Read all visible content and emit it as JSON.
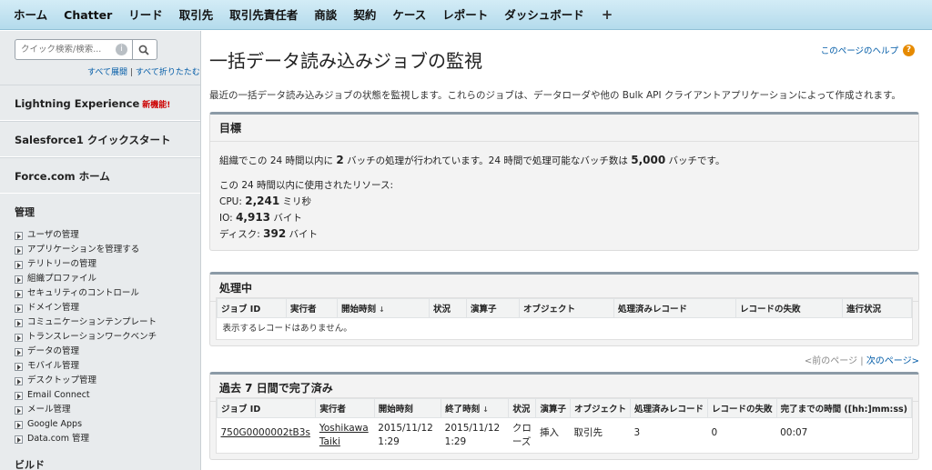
{
  "nav": {
    "tabs": [
      "ホーム",
      "Chatter",
      "リード",
      "取引先",
      "取引先責任者",
      "商談",
      "契約",
      "ケース",
      "レポート",
      "ダッシュボード"
    ],
    "plus": "+"
  },
  "sidebar": {
    "search_placeholder": "クイック検索/検索...",
    "expand_all": "すべて展開",
    "separator": "|",
    "collapse_all": "すべて折りたたむ",
    "lightning": "Lightning Experience",
    "lightning_badge": "新機能!",
    "sf1": "Salesforce1 クイックスタート",
    "forcecom": "Force.com ホーム",
    "admin_title": "管理",
    "admin_items": [
      "ユーザの管理",
      "アプリケーションを管理する",
      "テリトリーの管理",
      "組織プロファイル",
      "セキュリティのコントロール",
      "ドメイン管理",
      "コミュニケーションテンプレート",
      "トランスレーションワークベンチ",
      "データの管理",
      "モバイル管理",
      "デスクトップ管理",
      "Email Connect",
      "メール管理",
      "Google Apps",
      "Data.com 管理"
    ],
    "build_title": "ビルド"
  },
  "page": {
    "title": "一括データ読み込みジョブの監視",
    "help": "このページのヘルプ",
    "intro": "最近の一括データ読み込みジョブの状態を監視します。これらのジョブは、データローダや他の Bulk API クライアントアプリケーションによって作成されます。"
  },
  "goals": {
    "title": "目標",
    "line1_a": "組織でこの 24 時間以内に ",
    "line1_b": "2",
    "line1_c": " バッチの処理が行われています。24 時間で処理可能なバッチ数は ",
    "line1_d": "5,000",
    "line1_e": " バッチです。",
    "resources": "この 24 時間以内に使用されたリソース:",
    "cpu_label": "CPU: ",
    "cpu_value": "2,241",
    "cpu_unit": " ミリ秒",
    "io_label": "IO: ",
    "io_value": "4,913",
    "io_unit": " バイト",
    "disk_label": "ディスク: ",
    "disk_value": "392",
    "disk_unit": " バイト"
  },
  "in_progress": {
    "title": "処理中",
    "columns": [
      "ジョブ ID",
      "実行者",
      "開始時刻",
      "状況",
      "演算子",
      "オブジェクト",
      "処理済みレコード",
      "レコードの失敗",
      "進行状況"
    ],
    "empty": "表示するレコードはありません。",
    "sort_arrow": "↓"
  },
  "pager": {
    "prev": "<前のページ",
    "sep": "|",
    "next": "次のページ>"
  },
  "completed": {
    "title": "過去 7 日間で完了済み",
    "columns": [
      "ジョブ ID",
      "実行者",
      "開始時刻",
      "終了時刻",
      "状況",
      "演算子",
      "オブジェクト",
      "処理済みレコード",
      "レコードの失敗",
      "完了までの時間 ([hh:]mm:ss)"
    ],
    "sort_arrow": "↓",
    "row": {
      "job_id": "750G0000002tB3s",
      "user_1": "Yoshikawa",
      "user_2": "Taiki",
      "start_1": "2015/11/12",
      "start_2": "1:29",
      "end_1": "2015/11/12",
      "end_2": "1:29",
      "status_1": "クロ",
      "status_2": "ーズ",
      "operation": "挿入",
      "object": "取引先",
      "processed": "3",
      "failed": "0",
      "time": "00:07"
    }
  },
  "colors": {
    "nav_bg": "#c3e4f1",
    "link": "#015ba7",
    "new_badge": "#cc0000",
    "help_icon": "#e68a00"
  }
}
